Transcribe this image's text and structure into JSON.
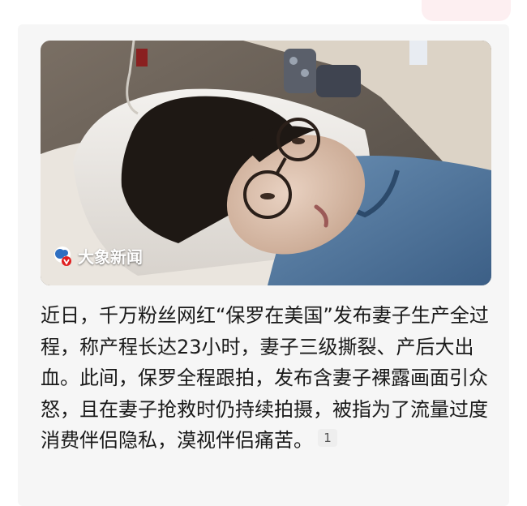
{
  "media": {
    "watermark": "大象新闻",
    "watermark_icon": "elephant-v-logo-icon"
  },
  "article": {
    "text": "近日，千万粉丝网红“保罗在美国”发布妻子生产全过程，称产程长达23小时，妻子三级撕裂、产后大出血。此间，保罗全程跟拍，发布含妻子裸露画面引众怒，且在妻子抢救时仍持续拍摄，被指为了流量过度消费伴侣隐私，漠视伴侣痛苦。",
    "reference_badge": "1"
  },
  "colors": {
    "text": "#1a1a1a",
    "badge_bg": "#eeeeee",
    "card_bg": "#f6f6f6",
    "accent_tab": "#fdeff1"
  }
}
